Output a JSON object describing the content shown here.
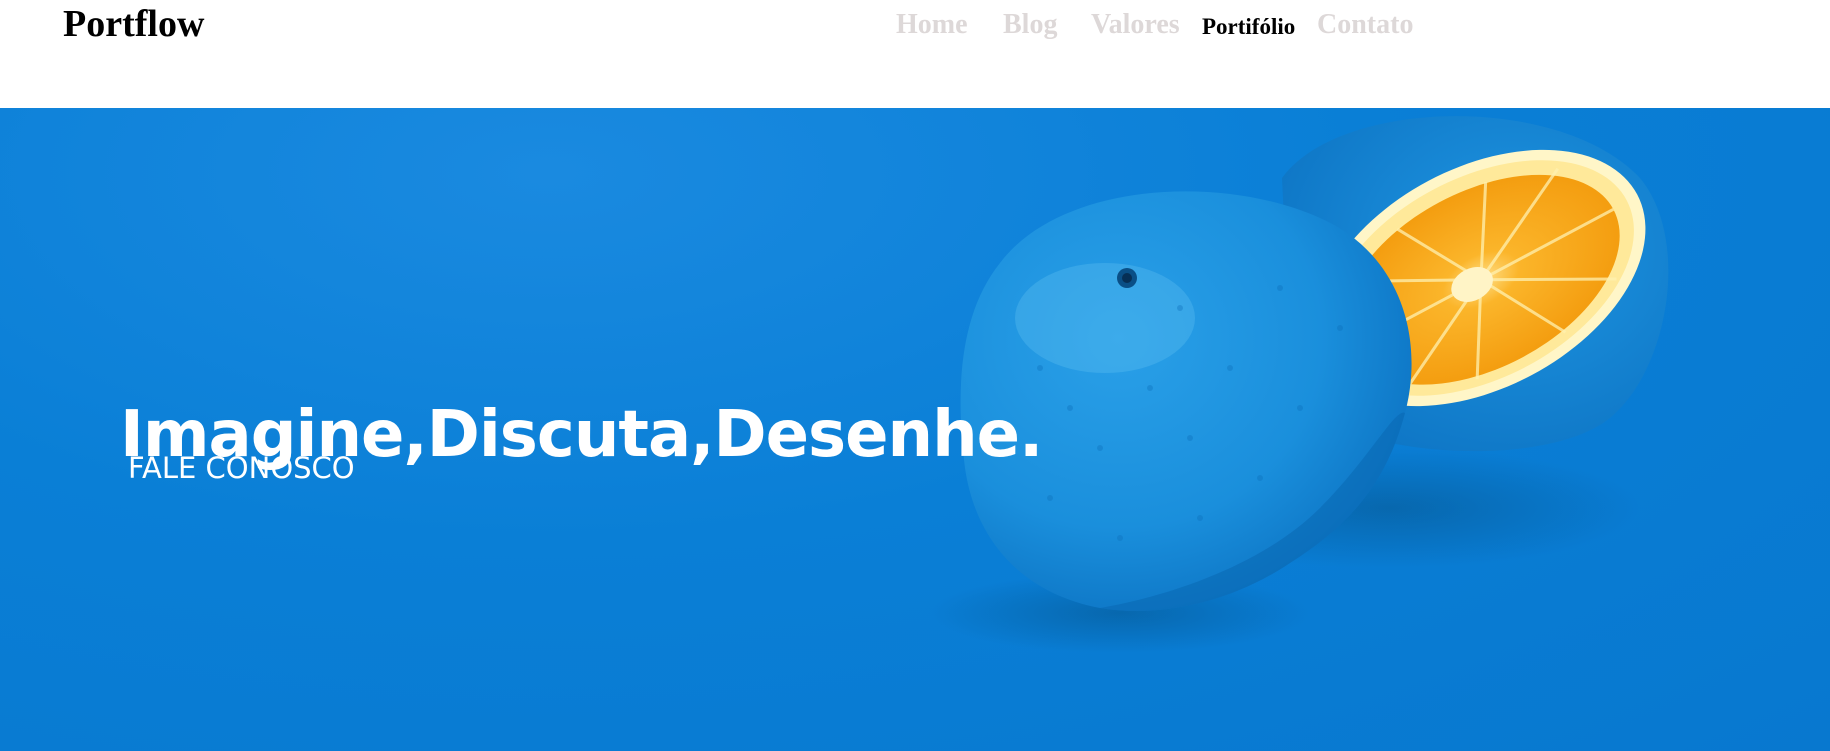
{
  "header": {
    "logo": "Portflow",
    "nav": {
      "home": "Home",
      "blog": "Blog",
      "valores": "Valores",
      "portfolio": "Portifólio",
      "contato": "Contato"
    }
  },
  "hero": {
    "title": "Imagine,Discuta,Desenhe.",
    "cta": "FALE CONOSCO",
    "image": "blue-painted-orange-cut-open",
    "background_color": "#0a7fd6"
  },
  "colors": {
    "nav_inactive": "#ddd8d8",
    "nav_active": "#000000",
    "hero_blue": "#0a7fd6",
    "orange_flesh": "#f7a10f"
  }
}
